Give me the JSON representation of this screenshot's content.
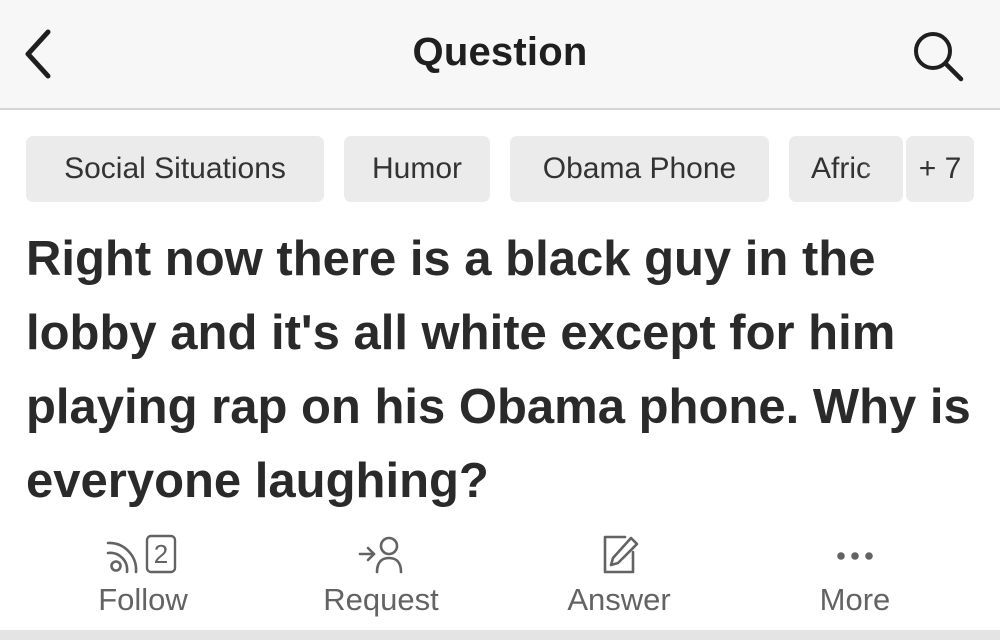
{
  "header": {
    "title": "Question",
    "back_icon": "chevron-left-icon",
    "search_icon": "search-icon"
  },
  "topics": {
    "items": [
      "Social Situations",
      "Humor",
      "Obama Phone",
      "Afric"
    ],
    "more_label": "+ 7"
  },
  "question": {
    "text": "Right now there is a black guy in the lobby and it's all white except for him playing rap on his Obama phone. Why is everyone laughing?"
  },
  "actions": {
    "follow": {
      "label": "Follow",
      "count": "2",
      "icon": "follow-feed-icon"
    },
    "request": {
      "label": "Request",
      "icon": "request-person-icon"
    },
    "answer": {
      "label": "Answer",
      "icon": "pencil-edit-icon"
    },
    "more": {
      "label": "More",
      "icon": "more-dots-icon"
    }
  },
  "colors": {
    "header_bg": "#f7f7f7",
    "chip_bg": "#ebebeb",
    "text_dark": "#2a2a2a",
    "text_muted": "#636363"
  }
}
